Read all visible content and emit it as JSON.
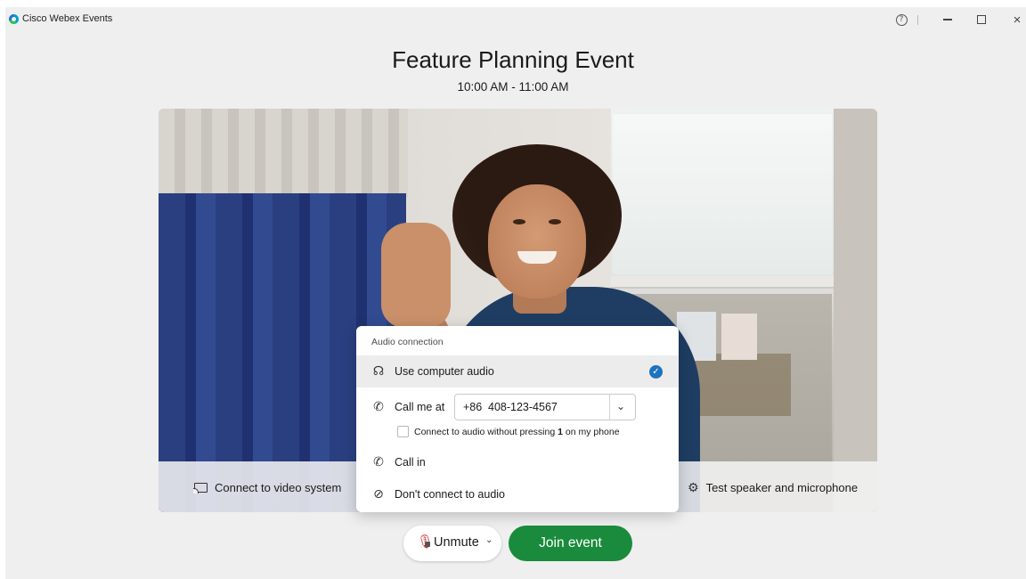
{
  "window": {
    "app_title": "Cisco Webex Events",
    "help_glyph": "?",
    "close_glyph": "×"
  },
  "event": {
    "title": "Feature Planning Event",
    "time": "10:00 AM - 11:00 AM"
  },
  "preview_bar": {
    "connect_video_label": "Connect to video system",
    "test_speaker_label": "Test speaker and microphone"
  },
  "audio_popup": {
    "title": "Audio connection",
    "options": {
      "computer_audio": "Use computer audio",
      "call_me": "Call me at",
      "call_in": "Call in",
      "dont_connect": "Don't connect to audio"
    },
    "phone": {
      "country_code": "+86",
      "number": "408-123-4567"
    },
    "checkbox_prefix": "Connect to audio without pressing ",
    "checkbox_key": "1",
    "checkbox_suffix": " on my phone",
    "selected": "computer_audio"
  },
  "controls": {
    "unmute_label": "Unmute",
    "join_label": "Join event"
  },
  "colors": {
    "join_green": "#1a8b3c",
    "check_blue": "#1e73be",
    "mic_red": "#d0343a"
  },
  "icons": [
    "webex-logo-icon",
    "help-icon",
    "minimize-icon",
    "maximize-icon",
    "close-icon",
    "cast-icon",
    "gear-icon",
    "headset-icon",
    "phone-callback-icon",
    "phone-callin-icon",
    "no-audio-icon",
    "check-icon",
    "chevron-down-icon",
    "mic-muted-icon"
  ]
}
